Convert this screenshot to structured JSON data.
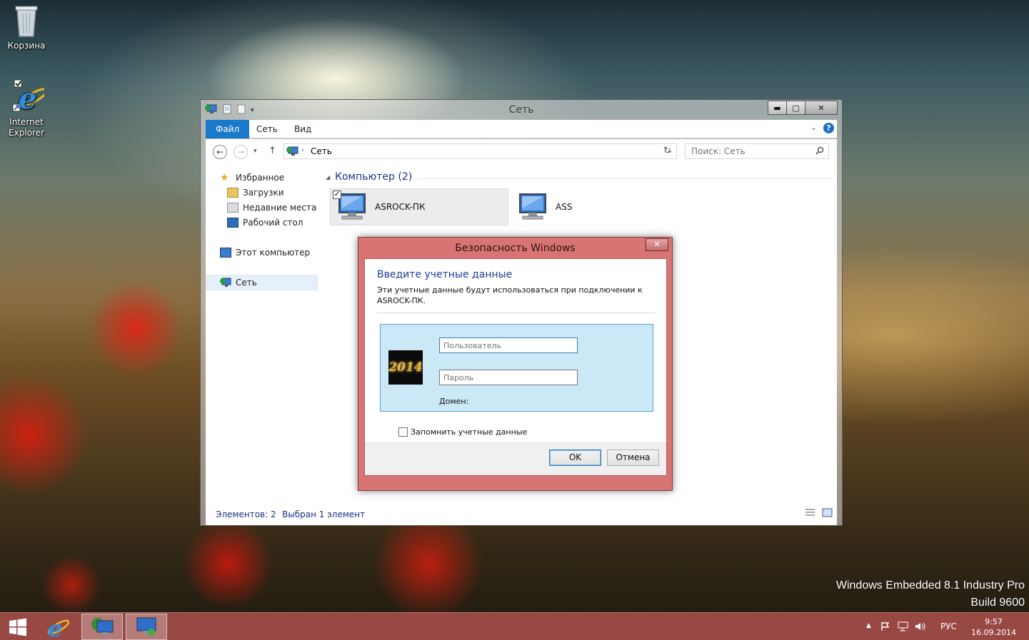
{
  "desktop": {
    "icons": [
      {
        "label": "Корзина"
      },
      {
        "label": "Internet Explorer"
      }
    ],
    "watermark": {
      "line1": "Windows Embedded 8.1 Industry Pro",
      "line2": "Build 9600"
    }
  },
  "explorer": {
    "title": "Сеть",
    "ribbon_tabs": [
      "Файл",
      "Сеть",
      "Вид"
    ],
    "address": {
      "path": "Сеть"
    },
    "search": {
      "placeholder": "Поиск: Сеть"
    },
    "nav": {
      "favorites": "Избранное",
      "downloads": "Загрузки",
      "recent": "Недавние места",
      "desktop": "Рабочий стол",
      "this_pc": "Этот компьютер",
      "network": "Сеть"
    },
    "group": {
      "header": "Компьютер (2)"
    },
    "items": [
      {
        "name": "ASROCK-ПК",
        "selected": true
      },
      {
        "name": "ASS",
        "selected": false
      }
    ],
    "status": {
      "count": "Элементов: 2",
      "selection": "Выбран 1 элемент"
    }
  },
  "dialog": {
    "title": "Безопасность Windows",
    "heading": "Введите учетные данные",
    "description": "Эти учетные данные будут использоваться при подключении к ASROCK-ПК.",
    "avatar_text": "2014",
    "username_placeholder": "Пользователь",
    "password_placeholder": "Пароль",
    "domain_label": "Домен:",
    "remember_label": "Запомнить учетные данные",
    "ok": "OK",
    "cancel": "Отмена"
  },
  "taskbar": {
    "tray": {
      "language": "РУС",
      "time": "9:57",
      "date": "16.09.2014"
    }
  },
  "colors": {
    "taskbar": "#aa504b",
    "dialog_frame": "#d66969",
    "ribbon_file": "#1979ca",
    "accent_text": "#1e3287"
  }
}
